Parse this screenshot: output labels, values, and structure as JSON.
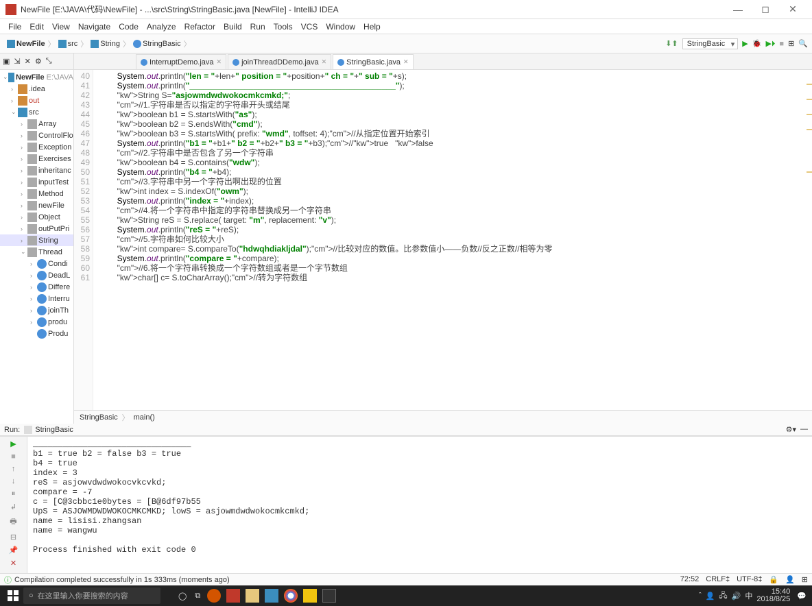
{
  "window": {
    "title": "NewFile [E:\\JAVA\\代码\\NewFile] - ...\\src\\String\\StringBasic.java [NewFile] - IntelliJ IDEA"
  },
  "menu": [
    "File",
    "Edit",
    "View",
    "Navigate",
    "Code",
    "Analyze",
    "Refactor",
    "Build",
    "Run",
    "Tools",
    "VCS",
    "Window",
    "Help"
  ],
  "breadcrumbs": {
    "b0": "NewFile",
    "b1": "src",
    "b2": "String",
    "b3": "StringBasic"
  },
  "run_config": "StringBasic",
  "tabs": {
    "t1": "InterruptDemo.java",
    "t2": "joinThreadDDemo.java",
    "t3": "StringBasic.java"
  },
  "tree": {
    "root": "NewFile",
    "root_path": "E:\\JAVA",
    "n_idea": ".idea",
    "n_out": "out",
    "n_src": "src",
    "n_array": "Array",
    "n_ctrl": "ControlFlo",
    "n_exc": "Exception",
    "n_exer": "Exercises",
    "n_inh": "inheritanc",
    "n_inp": "inputTest",
    "n_meth": "Method",
    "n_new": "newFile",
    "n_obj": "Object",
    "n_outp": "outPutPri",
    "n_str": "String",
    "n_thr": "Thread",
    "n_cond": "Condi",
    "n_dead": "DeadL",
    "n_diff": "Differe",
    "n_intr": "Interru",
    "n_join": "joinTh",
    "n_prod": "produ",
    "n_prod2": "Produ"
  },
  "lines": {
    "first": 40,
    "last": 61
  },
  "code": {
    "l40": "System.out.println(\"len = \"+len+\" position = \"+position+\" ch = \"+\" sub = \"+s);",
    "l41": "System.out.println(\"_____________________________________________\");",
    "l42": "String S=\"asjowmdwdwokocmkcmkd;\";",
    "l43": "//1.字符串是否以指定的字符串开头或结尾",
    "l44": "boolean b1 = S.startsWith(\"as\");",
    "l45": "boolean b2 = S.endsWith(\"cmd\");",
    "l46": "boolean b3 = S.startsWith( prefix: \"wmd\", toffset: 4);//从指定位置开始索引",
    "l47": "System.out.println(\"b1 = \"+b1+\" b2 = \"+b2+\" b3 = \"+b3);//true   false",
    "l48": "//2.字符串中是否包含了另一个字符串",
    "l49": "boolean b4 = S.contains(\"wdw\");",
    "l50": "System.out.println(\"b4 = \"+b4);",
    "l51": "//3.字符串中另一个字符出啊出现的位置",
    "l52": "int index = S.indexOf(\"owm\");",
    "l53": "System.out.println(\"index = \"+index);",
    "l54": "//4.将一个字符串中指定的字符串替换成另一个字符串",
    "l55": "String reS = S.replace( target: \"m\", replacement: \"v\");",
    "l56": "System.out.println(\"reS = \"+reS);",
    "l57": "//5.字符串如何比较大小",
    "l58": "int compare= S.compareTo(\"hdwqhdiakljdal\");//比较对应的数值。比参数值小——负数//反之正数//相等为零",
    "l59": "System.out.println(\"compare = \"+compare);",
    "l60": "//6.将一个字符串转换成一个字符数组或者是一个字节数组",
    "l61": "char[] c= S.toCharArray();//转为字符数组"
  },
  "breadcrumb2": {
    "c1": "StringBasic",
    "c2": "main()"
  },
  "run_tab": "StringBasic",
  "console": {
    "l1": "________________________________",
    "l2": "b1 = true b2 = false b3 = true",
    "l3": "b4 = true",
    "l4": "index = 3",
    "l5": "reS = asjowvdwdwokocvkcvkd;",
    "l6": "compare = -7",
    "l7": "c = [C@3cbbc1e0bytes = [B@6df97b55",
    "l8": "UpS = ASJOWMDWDWOKOCMKCMKD; lowS = asjowmdwdwokocmkcmkd;",
    "l9": "name = lisisi.zhangsan",
    "l10": "name = wangwu",
    "l11": "",
    "l12": "Process finished with exit code 0"
  },
  "status": {
    "msg": "Compilation completed successfully in 1s 333ms (moments ago)",
    "pos": "72:52",
    "eol": "CRLF‡",
    "enc": "UTF-8‡"
  },
  "taskbar": {
    "search_placeholder": "在这里输入你要搜索的内容",
    "time": "15:40",
    "date": "2018/8/25"
  }
}
